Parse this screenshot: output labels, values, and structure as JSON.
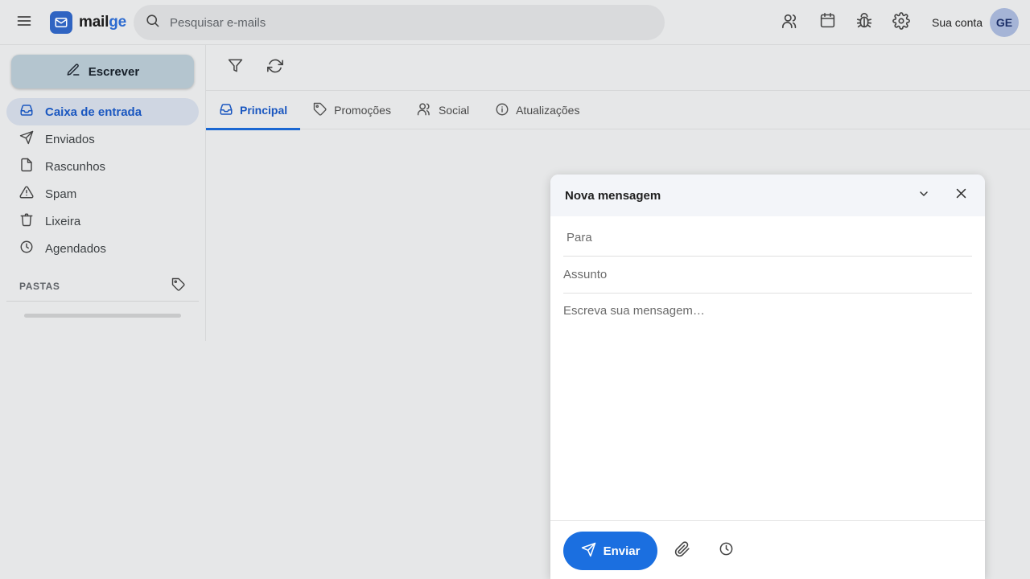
{
  "header": {
    "brand_part1": "mail",
    "brand_part2": "ge",
    "search_placeholder": "Pesquisar e-mails",
    "account_label": "Sua conta",
    "avatar_initials": "GE",
    "icons": [
      "menu-icon",
      "contacts-icon",
      "calendar-icon",
      "bug-icon",
      "settings-icon"
    ]
  },
  "sidebar": {
    "compose_label": "Escrever",
    "items": [
      {
        "label": "Caixa de entrada",
        "icon": "inbox-icon",
        "active": true
      },
      {
        "label": "Enviados",
        "icon": "send-icon"
      },
      {
        "label": "Rascunhos",
        "icon": "file-icon"
      },
      {
        "label": "Spam",
        "icon": "warning-icon"
      },
      {
        "label": "Lixeira",
        "icon": "trash-icon"
      },
      {
        "label": "Agendados",
        "icon": "clock-icon"
      }
    ],
    "folders_label": "PASTAS"
  },
  "toolbar": {
    "icons": [
      "filter-icon",
      "refresh-icon"
    ]
  },
  "tabs": [
    {
      "label": "Principal",
      "icon": "inbox-icon",
      "active": true
    },
    {
      "label": "Promoções",
      "icon": "tag-icon"
    },
    {
      "label": "Social",
      "icon": "users-icon"
    },
    {
      "label": "Atualizações",
      "icon": "info-icon"
    }
  ],
  "compose": {
    "title": "Nova mensagem",
    "to_placeholder": "Para",
    "subject_placeholder": "Assunto",
    "body_placeholder": "Escreva sua mensagem…",
    "send_label": "Enviar"
  },
  "colors": {
    "accent": "#1b6fe0",
    "brand": "#2f64c2",
    "active_nav_bg": "#cfd6e2",
    "overlay_bg": "#e6e7e8"
  }
}
